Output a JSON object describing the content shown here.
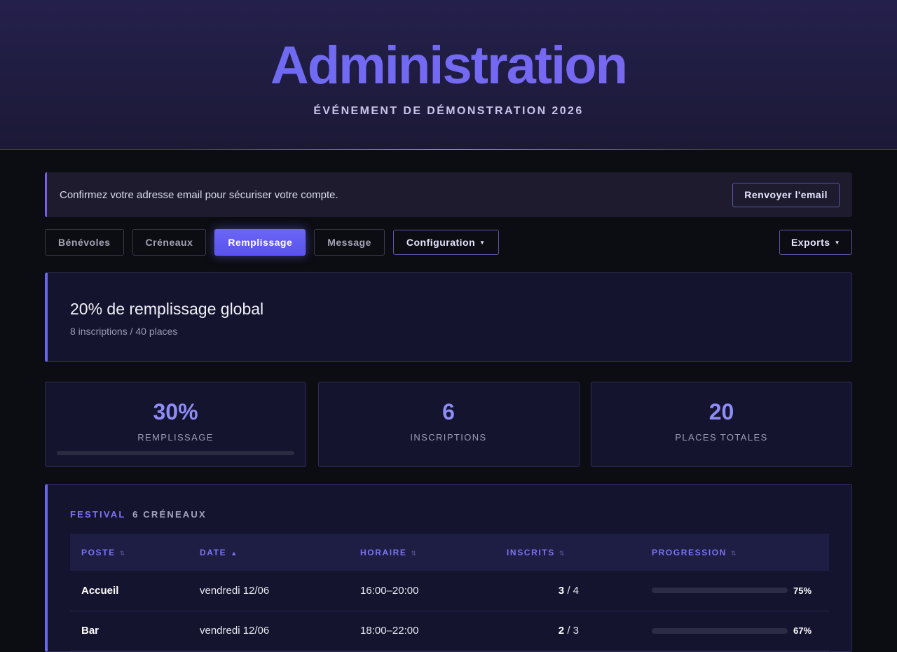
{
  "header": {
    "title": "Administration",
    "subtitle": "ÉVÉNEMENT DE DÉMONSTRATION 2026"
  },
  "notice": {
    "message": "Confirmez votre adresse email pour sécuriser votre compte.",
    "button_label": "Renvoyer l'email"
  },
  "tabs": {
    "benevoles": "Bénévoles",
    "creneaux": "Créneaux",
    "remplissage": "Remplissage",
    "message": "Message",
    "configuration": "Configuration",
    "exports": "Exports",
    "caret": "▼"
  },
  "summary": {
    "headline": "20% de remplissage global",
    "detail": "8 inscriptions / 40 places"
  },
  "stats": {
    "fill": {
      "value": "30%",
      "label": "REMPLISSAGE",
      "progress_fraction": 0.3
    },
    "inscriptions": {
      "value": "6",
      "label": "INSCRIPTIONS"
    },
    "places": {
      "value": "20",
      "label": "PLACES TOTALES"
    }
  },
  "section": {
    "title": "FESTIVAL",
    "count": "6 CRÉNEAUX",
    "columns": {
      "poste": "POSTE",
      "date": "DATE",
      "horaire": "HORAIRE",
      "inscrits": "INSCRITS",
      "progression": "PROGRESSION"
    },
    "sort_icon": "⇅",
    "sort_active_icon": "▲",
    "rows": [
      {
        "poste": "Accueil",
        "date": "vendredi 12/06",
        "horaire": "16:00–20:00",
        "inscrits": "3",
        "places": "/ 4",
        "pct": "75%",
        "progress_fraction": 0.75
      },
      {
        "poste": "Bar",
        "date": "vendredi 12/06",
        "horaire": "18:00–22:00",
        "inscrits": "2",
        "places": "/ 3",
        "pct": "67%",
        "progress_fraction": 0.67
      }
    ]
  },
  "colors": {
    "accent": "#6a66f5",
    "background": "#0c0d12",
    "panel": "#15142f"
  }
}
